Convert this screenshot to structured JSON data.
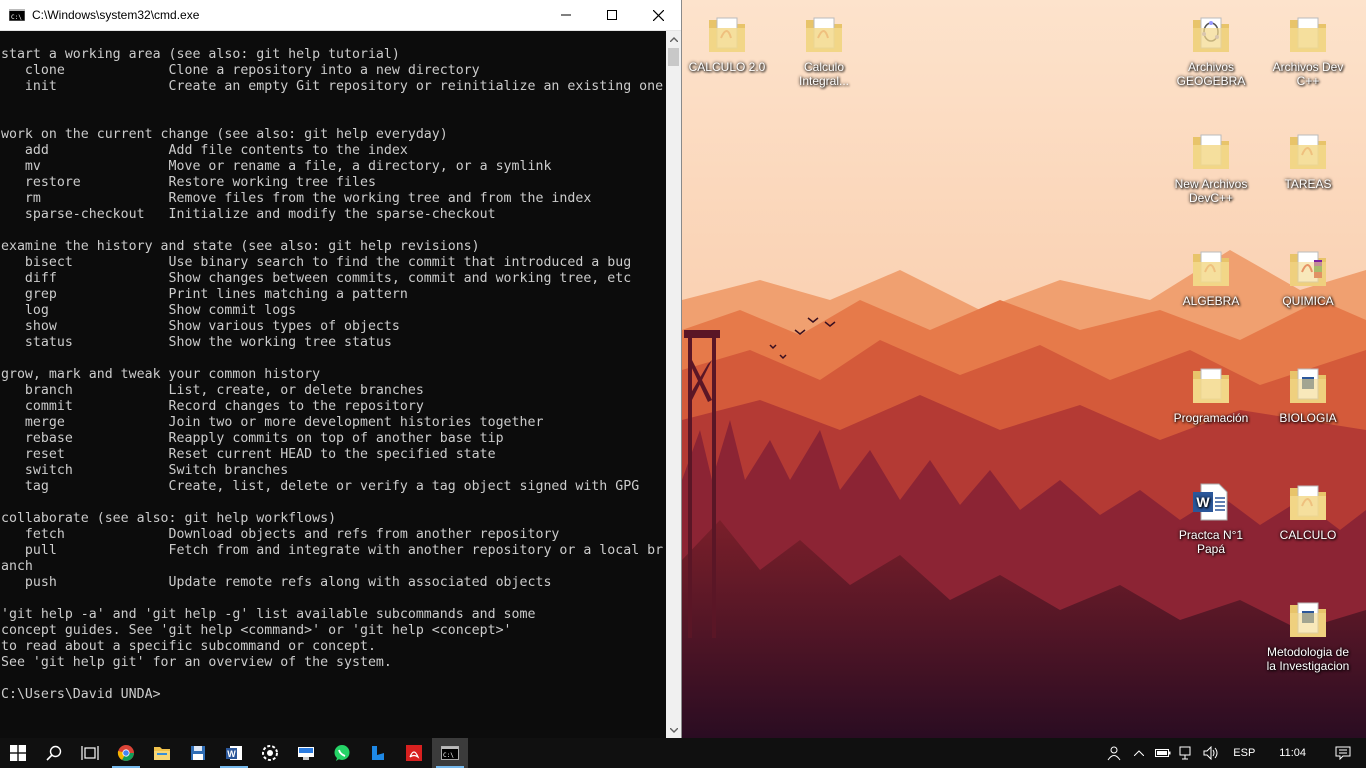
{
  "window": {
    "title": "C:\\Windows\\system32\\cmd.exe",
    "minimize_icon": "minimize-icon",
    "maximize_icon": "maximize-icon",
    "close_icon": "close-icon"
  },
  "terminal": {
    "lines": [
      "start a working area (see also: git help tutorial)",
      "   clone             Clone a repository into a new directory",
      "   init              Create an empty Git repository or reinitialize an existing one",
      "",
      "",
      "work on the current change (see also: git help everyday)",
      "   add               Add file contents to the index",
      "   mv                Move or rename a file, a directory, or a symlink",
      "   restore           Restore working tree files",
      "   rm                Remove files from the working tree and from the index",
      "   sparse-checkout   Initialize and modify the sparse-checkout",
      "",
      "examine the history and state (see also: git help revisions)",
      "   bisect            Use binary search to find the commit that introduced a bug",
      "   diff              Show changes between commits, commit and working tree, etc",
      "   grep              Print lines matching a pattern",
      "   log               Show commit logs",
      "   show              Show various types of objects",
      "   status            Show the working tree status",
      "",
      "grow, mark and tweak your common history",
      "   branch            List, create, or delete branches",
      "   commit            Record changes to the repository",
      "   merge             Join two or more development histories together",
      "   rebase            Reapply commits on top of another base tip",
      "   reset             Reset current HEAD to the specified state",
      "   switch            Switch branches",
      "   tag               Create, list, delete or verify a tag object signed with GPG",
      "",
      "collaborate (see also: git help workflows)",
      "   fetch             Download objects and refs from another repository",
      "   pull              Fetch from and integrate with another repository or a local br",
      "anch",
      "   push              Update remote refs along with associated objects",
      "",
      "'git help -a' and 'git help -g' list available subcommands and some",
      "concept guides. See 'git help <command>' or 'git help <concept>'",
      "to read about a specific subcommand or concept.",
      "See 'git help git' for an overview of the system.",
      "",
      "C:\\Users\\David UNDA>"
    ]
  },
  "desktop_icons": [
    {
      "label": "CALCULO 2.0",
      "icon": "pdf-folder-icon"
    },
    {
      "label": "Calculo Integral...",
      "icon": "pdf-folder-icon"
    },
    {
      "label": "Archivos GEOGEBRA",
      "icon": "geogebra-folder-icon"
    },
    {
      "label": "Archivos Dev C++",
      "icon": "folder-icon"
    },
    {
      "label": "New Archivos DevC++",
      "icon": "folder-icon"
    },
    {
      "label": "TAREAS",
      "icon": "pdf-folder-icon"
    },
    {
      "label": "ALGEBRA",
      "icon": "pdf-folder-icon"
    },
    {
      "label": "QUIMICA",
      "icon": "winrar-folder-icon"
    },
    {
      "label": "Programación",
      "icon": "folder-icon"
    },
    {
      "label": "BIOLOGIA",
      "icon": "word-folder-icon"
    },
    {
      "label": "Practca N°1 Papá",
      "icon": "word-document-icon"
    },
    {
      "label": "CALCULO",
      "icon": "pdf-folder-icon"
    },
    {
      "label": "Metodologia de la Investigacion",
      "icon": "word-folder-icon"
    }
  ],
  "taskbar": {
    "start_icon": "windows-start-icon",
    "pinned": [
      {
        "name": "search-icon"
      },
      {
        "name": "task-view-icon"
      },
      {
        "name": "chrome-icon"
      },
      {
        "name": "file-explorer-icon"
      },
      {
        "name": "save-disk-icon"
      },
      {
        "name": "word-icon"
      },
      {
        "name": "settings-app-icon"
      },
      {
        "name": "network-app-icon"
      },
      {
        "name": "whatsapp-icon"
      },
      {
        "name": "blue-app-icon"
      },
      {
        "name": "acrobat-icon"
      },
      {
        "name": "cmd-icon"
      }
    ],
    "tray": {
      "language": "ESP",
      "time": "11:04"
    }
  },
  "colors": {
    "terminal_bg": "#0c0c0c",
    "terminal_fg": "#cccccc",
    "taskbar_bg": "#101010",
    "accent": "#76b9ed",
    "sky": "#f6c9a4",
    "mountain_far": "#e9855a",
    "forest_dark": "#5a1a2c"
  }
}
